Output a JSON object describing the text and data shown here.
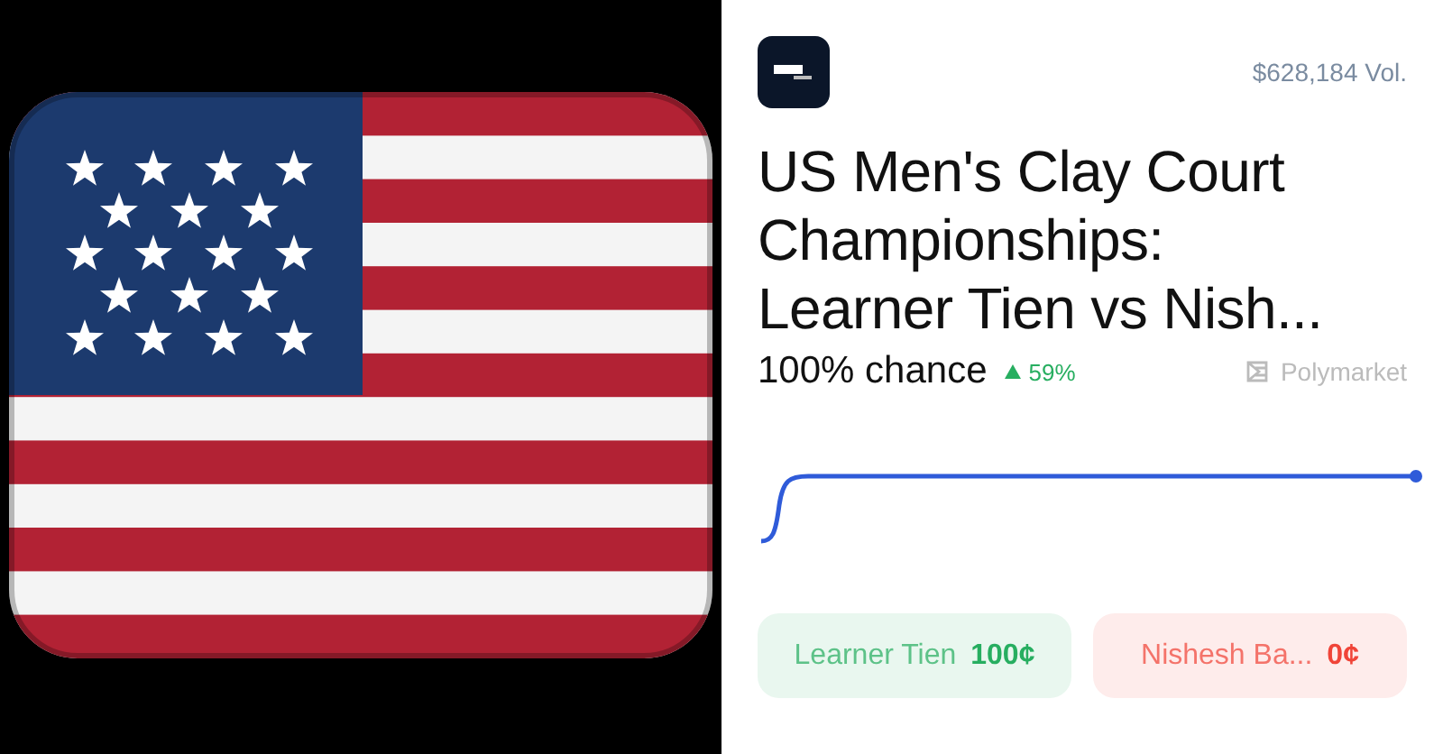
{
  "media": {
    "kind": "flag"
  },
  "header": {
    "volume": "$628,184 Vol."
  },
  "title": "US Men's Clay Court Championships: Learner Tien vs Nish...",
  "odds": {
    "chance": "100% chance",
    "change": "59%",
    "rising": true
  },
  "source": "Polymarket",
  "outcomes": [
    {
      "name": "Learner Tien",
      "price": "100¢",
      "color": "#27ae60"
    },
    {
      "name": "Nishesh Ba...",
      "price": "0¢",
      "color": "#f04438"
    }
  ]
}
